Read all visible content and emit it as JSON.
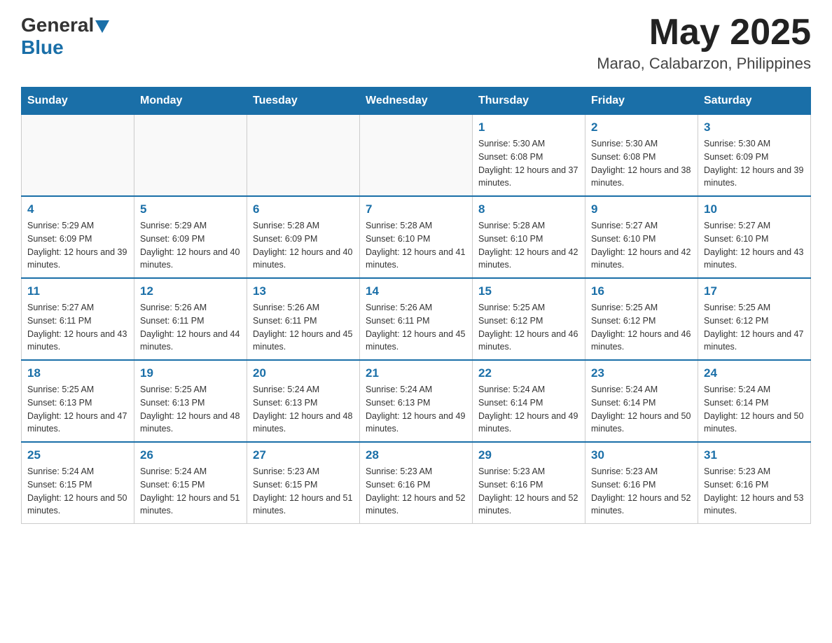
{
  "header": {
    "logo_general": "General",
    "logo_blue": "Blue",
    "month_year": "May 2025",
    "location": "Marao, Calabarzon, Philippines"
  },
  "days_of_week": [
    "Sunday",
    "Monday",
    "Tuesday",
    "Wednesday",
    "Thursday",
    "Friday",
    "Saturday"
  ],
  "weeks": [
    [
      {
        "day": "",
        "info": ""
      },
      {
        "day": "",
        "info": ""
      },
      {
        "day": "",
        "info": ""
      },
      {
        "day": "",
        "info": ""
      },
      {
        "day": "1",
        "info": "Sunrise: 5:30 AM\nSunset: 6:08 PM\nDaylight: 12 hours and 37 minutes."
      },
      {
        "day": "2",
        "info": "Sunrise: 5:30 AM\nSunset: 6:08 PM\nDaylight: 12 hours and 38 minutes."
      },
      {
        "day": "3",
        "info": "Sunrise: 5:30 AM\nSunset: 6:09 PM\nDaylight: 12 hours and 39 minutes."
      }
    ],
    [
      {
        "day": "4",
        "info": "Sunrise: 5:29 AM\nSunset: 6:09 PM\nDaylight: 12 hours and 39 minutes."
      },
      {
        "day": "5",
        "info": "Sunrise: 5:29 AM\nSunset: 6:09 PM\nDaylight: 12 hours and 40 minutes."
      },
      {
        "day": "6",
        "info": "Sunrise: 5:28 AM\nSunset: 6:09 PM\nDaylight: 12 hours and 40 minutes."
      },
      {
        "day": "7",
        "info": "Sunrise: 5:28 AM\nSunset: 6:10 PM\nDaylight: 12 hours and 41 minutes."
      },
      {
        "day": "8",
        "info": "Sunrise: 5:28 AM\nSunset: 6:10 PM\nDaylight: 12 hours and 42 minutes."
      },
      {
        "day": "9",
        "info": "Sunrise: 5:27 AM\nSunset: 6:10 PM\nDaylight: 12 hours and 42 minutes."
      },
      {
        "day": "10",
        "info": "Sunrise: 5:27 AM\nSunset: 6:10 PM\nDaylight: 12 hours and 43 minutes."
      }
    ],
    [
      {
        "day": "11",
        "info": "Sunrise: 5:27 AM\nSunset: 6:11 PM\nDaylight: 12 hours and 43 minutes."
      },
      {
        "day": "12",
        "info": "Sunrise: 5:26 AM\nSunset: 6:11 PM\nDaylight: 12 hours and 44 minutes."
      },
      {
        "day": "13",
        "info": "Sunrise: 5:26 AM\nSunset: 6:11 PM\nDaylight: 12 hours and 45 minutes."
      },
      {
        "day": "14",
        "info": "Sunrise: 5:26 AM\nSunset: 6:11 PM\nDaylight: 12 hours and 45 minutes."
      },
      {
        "day": "15",
        "info": "Sunrise: 5:25 AM\nSunset: 6:12 PM\nDaylight: 12 hours and 46 minutes."
      },
      {
        "day": "16",
        "info": "Sunrise: 5:25 AM\nSunset: 6:12 PM\nDaylight: 12 hours and 46 minutes."
      },
      {
        "day": "17",
        "info": "Sunrise: 5:25 AM\nSunset: 6:12 PM\nDaylight: 12 hours and 47 minutes."
      }
    ],
    [
      {
        "day": "18",
        "info": "Sunrise: 5:25 AM\nSunset: 6:13 PM\nDaylight: 12 hours and 47 minutes."
      },
      {
        "day": "19",
        "info": "Sunrise: 5:25 AM\nSunset: 6:13 PM\nDaylight: 12 hours and 48 minutes."
      },
      {
        "day": "20",
        "info": "Sunrise: 5:24 AM\nSunset: 6:13 PM\nDaylight: 12 hours and 48 minutes."
      },
      {
        "day": "21",
        "info": "Sunrise: 5:24 AM\nSunset: 6:13 PM\nDaylight: 12 hours and 49 minutes."
      },
      {
        "day": "22",
        "info": "Sunrise: 5:24 AM\nSunset: 6:14 PM\nDaylight: 12 hours and 49 minutes."
      },
      {
        "day": "23",
        "info": "Sunrise: 5:24 AM\nSunset: 6:14 PM\nDaylight: 12 hours and 50 minutes."
      },
      {
        "day": "24",
        "info": "Sunrise: 5:24 AM\nSunset: 6:14 PM\nDaylight: 12 hours and 50 minutes."
      }
    ],
    [
      {
        "day": "25",
        "info": "Sunrise: 5:24 AM\nSunset: 6:15 PM\nDaylight: 12 hours and 50 minutes."
      },
      {
        "day": "26",
        "info": "Sunrise: 5:24 AM\nSunset: 6:15 PM\nDaylight: 12 hours and 51 minutes."
      },
      {
        "day": "27",
        "info": "Sunrise: 5:23 AM\nSunset: 6:15 PM\nDaylight: 12 hours and 51 minutes."
      },
      {
        "day": "28",
        "info": "Sunrise: 5:23 AM\nSunset: 6:16 PM\nDaylight: 12 hours and 52 minutes."
      },
      {
        "day": "29",
        "info": "Sunrise: 5:23 AM\nSunset: 6:16 PM\nDaylight: 12 hours and 52 minutes."
      },
      {
        "day": "30",
        "info": "Sunrise: 5:23 AM\nSunset: 6:16 PM\nDaylight: 12 hours and 52 minutes."
      },
      {
        "day": "31",
        "info": "Sunrise: 5:23 AM\nSunset: 6:16 PM\nDaylight: 12 hours and 53 minutes."
      }
    ]
  ]
}
